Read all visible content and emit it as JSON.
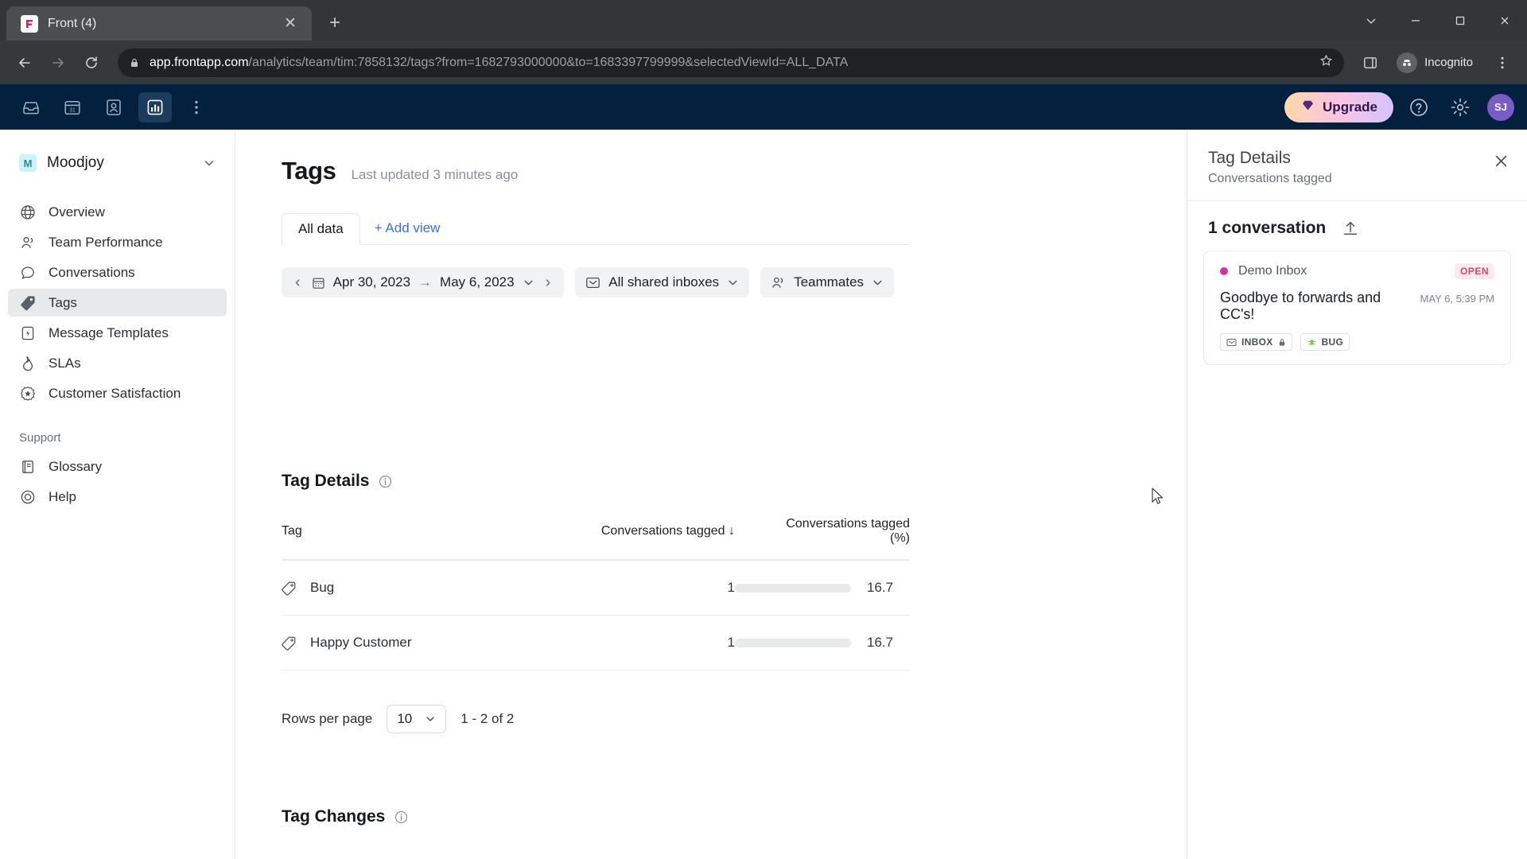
{
  "browser": {
    "tab_title": "Front (4)",
    "tab_close_glyph": "✕",
    "newtab_glyph": "+",
    "url_host": "app.frontapp.com",
    "url_path": "/analytics/team/tim:7858132/tags?from=1682793000000&to=1683397799999&selectedViewId=ALL_DATA",
    "incognito_label": "Incognito"
  },
  "app_header": {
    "upgrade_label": "Upgrade",
    "avatar_initials": "SJ"
  },
  "sidebar": {
    "workspace": "Moodjoy",
    "workspace_initial": "M",
    "items": [
      {
        "label": "Overview",
        "icon": "globe-icon",
        "active": false
      },
      {
        "label": "Team Performance",
        "icon": "people-icon",
        "active": false
      },
      {
        "label": "Conversations",
        "icon": "chat-bubble-icon",
        "active": false
      },
      {
        "label": "Tags",
        "icon": "tag-icon",
        "active": true
      },
      {
        "label": "Message Templates",
        "icon": "template-icon",
        "active": false
      },
      {
        "label": "SLAs",
        "icon": "flame-icon",
        "active": false
      },
      {
        "label": "Customer Satisfaction",
        "icon": "star-badge-icon",
        "active": false
      }
    ],
    "support_section": "Support",
    "support_items": [
      {
        "label": "Glossary",
        "icon": "book-icon"
      },
      {
        "label": "Help",
        "icon": "lifebuoy-icon"
      }
    ]
  },
  "main": {
    "page_title": "Tags",
    "last_updated": "Last updated 3 minutes ago",
    "tabs": [
      {
        "label": "All data",
        "active": true
      }
    ],
    "add_view_label": "+ Add view",
    "filters": {
      "date_from": "Apr 30, 2023",
      "date_to": "May 6, 2023",
      "date_arrow": "→",
      "prev_glyph": "‹",
      "next_glyph": "›",
      "inboxes_label": "All shared inboxes",
      "teammates_label": "Teammates"
    },
    "tag_details": {
      "title": "Tag Details",
      "columns": [
        "Tag",
        "Conversations tagged ↓",
        "Conversations tagged (%)"
      ],
      "rows": [
        {
          "tag": "Bug",
          "count": "1",
          "pct_text": "16.7",
          "pct_value": 16.7
        },
        {
          "tag": "Happy Customer",
          "count": "1",
          "pct_text": "16.7",
          "pct_value": 16.7
        }
      ],
      "rows_per_page_label": "Rows per page",
      "rows_per_page_value": "10",
      "range_label": "1 - 2 of 2"
    },
    "tag_changes": {
      "title": "Tag Changes"
    }
  },
  "right_panel": {
    "title": "Tag Details",
    "subtitle": "Conversations tagged",
    "count_label": "1 conversation",
    "conversation": {
      "inbox": "Demo Inbox",
      "status": "OPEN",
      "subject": "Goodbye to forwards and CC's!",
      "time": "MAY 6, 5:39 PM",
      "tags": [
        {
          "label": "INBOX",
          "icon": "inbox-icon"
        },
        {
          "label": "BUG",
          "icon": "bug-icon"
        }
      ]
    }
  },
  "chart_data": {
    "type": "bar",
    "title": "Tag Details",
    "categories": [
      "Bug",
      "Happy Customer"
    ],
    "series": [
      {
        "name": "Conversations tagged",
        "values": [
          1,
          1
        ]
      },
      {
        "name": "Conversations tagged (%)",
        "values": [
          16.7,
          16.7
        ]
      }
    ],
    "xlabel": "Tag",
    "ylabel": "Conversations tagged",
    "ylim": [
      0,
      100
    ],
    "grid": false,
    "legend": "none"
  }
}
